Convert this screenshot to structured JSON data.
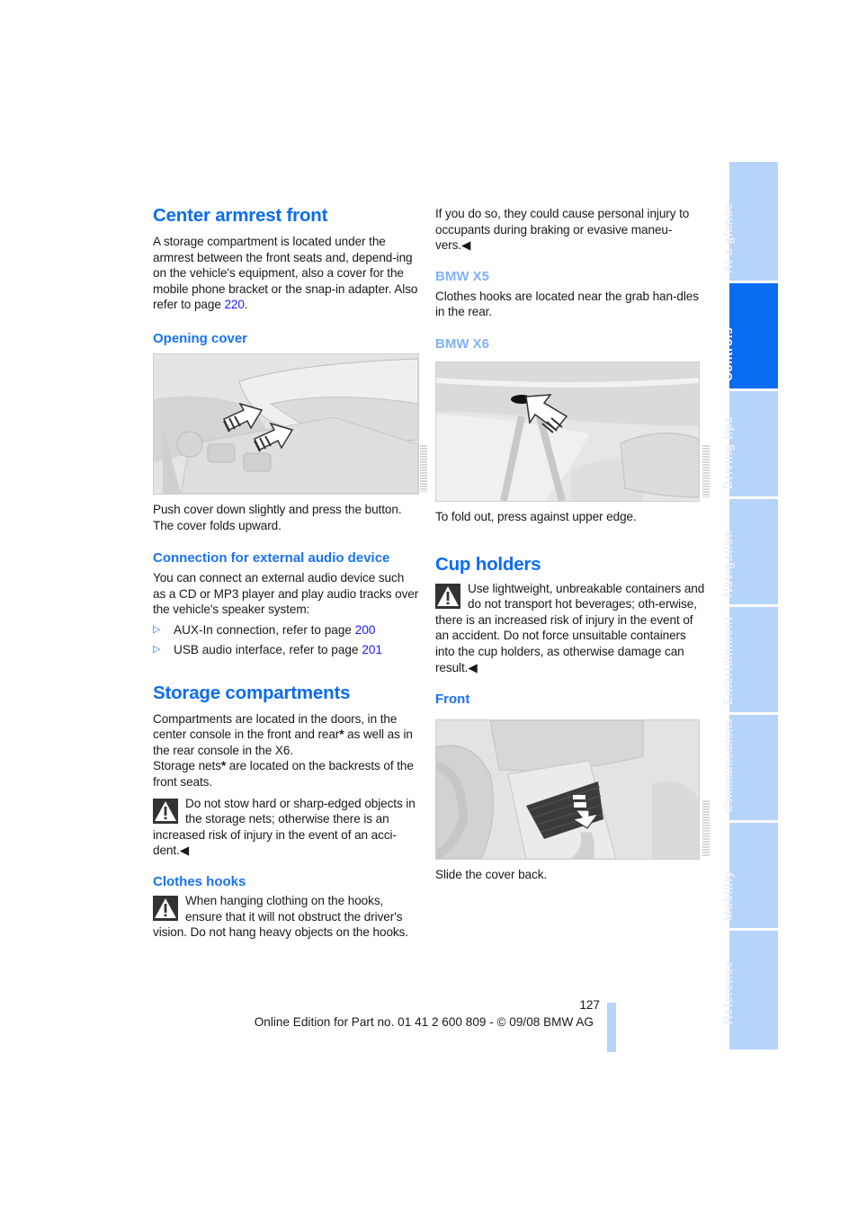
{
  "page": {
    "number": "127",
    "footer": "Online Edition for Part no. 01 41 2 600 809 - © 09/08 BMW AG",
    "accent_color": "#0a6cf2",
    "tab_color": "#b6d3fb"
  },
  "sidebar": {
    "tabs": [
      {
        "label": "At a glance",
        "active": false
      },
      {
        "label": "Controls",
        "active": true
      },
      {
        "label": "Driving tips",
        "active": false
      },
      {
        "label": "Navigation",
        "active": false
      },
      {
        "label": "Entertainment",
        "active": false
      },
      {
        "label": "Communications",
        "active": false
      },
      {
        "label": "Mobility",
        "active": false
      },
      {
        "label": "Reference",
        "active": false
      }
    ]
  },
  "left": {
    "armrest": {
      "title": "Center armrest front",
      "body": "A storage compartment is located under the armrest between the front seats and, depend-ing on the vehicle's equipment, also a cover for the mobile phone bracket or the snap-in adapter. Also refer to page ",
      "page_ref": "220",
      "body_end": "."
    },
    "opening_cover": {
      "title": "Opening cover",
      "figure_alt": "Center armrest with arrows pointing to release button",
      "caption": "Push cover down slightly and press the button. The cover folds upward."
    },
    "audio": {
      "title": "Connection for external audio device",
      "body": "You can connect an external audio device such as a CD or MP3 player and play audio tracks over the vehicle's speaker system:",
      "bullets": [
        {
          "text": "AUX-In connection, refer to page ",
          "page_ref": "200"
        },
        {
          "text": "USB audio interface, refer to page ",
          "page_ref": "201"
        }
      ]
    },
    "storage": {
      "title": "Storage compartments",
      "body1_a": "Compartments are located in the doors, in the center console in the front and rear",
      "asterisk": "*",
      "body1_b": " as well as in the rear console in the X6.",
      "body2_a": "Storage nets",
      "body2_b": " are located on the backrests of the front seats.",
      "warning": "Do not stow hard or sharp-edged objects in the storage nets; otherwise there is an increased risk of injury in the event of an acci-dent.",
      "end_mark": "◀"
    },
    "clothes_hooks": {
      "title": "Clothes hooks",
      "warning": "When hanging clothing on the hooks, ensure that it will not obstruct the driver's vision. Do not hang heavy objects on the hooks."
    }
  },
  "right": {
    "continued": "If you do so, they could cause personal injury to occupants during braking or evasive maneu-vers.",
    "end_mark": "◀",
    "x5": {
      "title": "BMW X5",
      "body": "Clothes hooks are located near the grab han-dles in the rear."
    },
    "x6": {
      "title": "BMW X6",
      "figure_alt": "Clothes hook at the roof liner with arrow",
      "caption": "To fold out, press against upper edge."
    },
    "cup_holders": {
      "title": "Cup holders",
      "warning": "Use lightweight, unbreakable containers and do not transport hot beverages; oth-erwise, there is an increased risk of injury in the event of an accident. Do not force unsuitable containers into the cup holders, as otherwise damage can result."
    },
    "front": {
      "title": "Front",
      "figure_alt": "Center console cup holder cover with arrow",
      "caption": "Slide the cover back."
    }
  }
}
